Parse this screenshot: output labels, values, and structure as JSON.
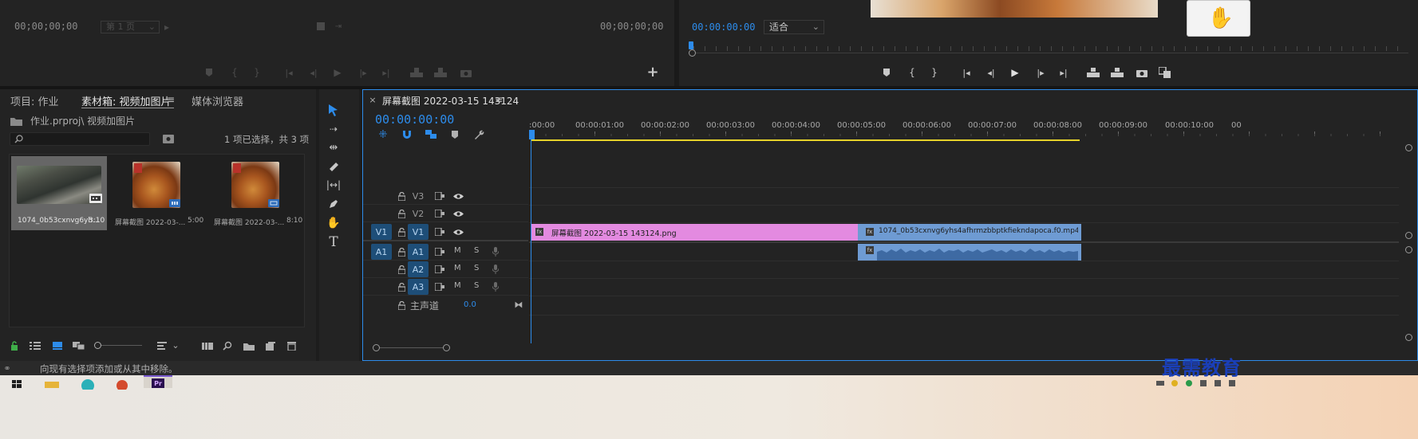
{
  "source_monitor": {
    "timecode_left": "00;00;00;00",
    "page_select": "第 1 页",
    "timecode_right": "00;00;00;00"
  },
  "program_monitor": {
    "timecode": "00:00:00:00",
    "zoom_select": "适合"
  },
  "project_panel": {
    "tabs": [
      {
        "label": "项目: 作业"
      },
      {
        "label": "素材箱: 视频加图片"
      },
      {
        "label": "媒体浏览器"
      }
    ],
    "path": "作业.prproj\\ 视频加图片",
    "selection_status": "1 项已选择，共 3 项",
    "items": [
      {
        "name": "1074_0b53cxnvg6yh...",
        "duration": "3:10",
        "kind": "video"
      },
      {
        "name": "屏幕截图 2022-03-...",
        "duration": "5:00",
        "kind": "image"
      },
      {
        "name": "屏幕截图 2022-03-...",
        "duration": "8:10",
        "kind": "image"
      }
    ]
  },
  "timeline": {
    "tab_title": "屏幕截图 2022-03-15 143124",
    "timecode": "00:00:00:00",
    "ruler_labels": [
      ":00:00",
      "00:00:01:00",
      "00:00:02:00",
      "00:00:03:00",
      "00:00:04:00",
      "00:00:05:00",
      "00:00:06:00",
      "00:00:07:00",
      "00:00:08:00",
      "00:00:09:00",
      "00:00:10:00",
      "00"
    ],
    "video_tracks": [
      "V3",
      "V2",
      "V1"
    ],
    "audio_tracks": [
      "A1",
      "A2",
      "A3"
    ],
    "source_patch_video": "V1",
    "source_patch_audio": "A1",
    "mute_label": "M",
    "solo_label": "S",
    "master_label": "主声道",
    "master_value": "0.0",
    "clips": {
      "image_clip": "屏幕截图 2022-03-15 143124.png",
      "video_clip": "1074_0b53cxnvg6yhs4afhrmzbbptkfiekndapoca.f0.mp4 [V]"
    }
  },
  "status_bar": {
    "message": "向现有选择项添加或从其中移除。"
  },
  "watermark": "最需教育",
  "colors": {
    "accent_blue": "#2d8ceb",
    "image_clip": "#e38ae0",
    "video_clip": "#6e9bd3",
    "work_area": "#e6d22a"
  }
}
